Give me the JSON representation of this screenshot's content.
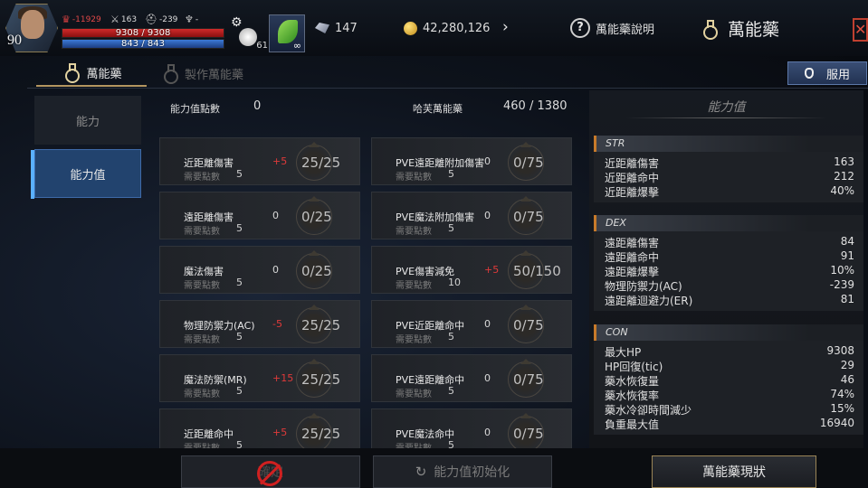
{
  "player": {
    "level": "90",
    "lawful": "-11929",
    "attack": "163",
    "defense": "-239",
    "trophy": "-",
    "hp": "9308 / 9308",
    "mp": "843 / 843",
    "pet_count": "61",
    "potion_count": "∞"
  },
  "currency": {
    "crystals": "147",
    "gold": "42,280,126"
  },
  "header": {
    "help_label": "萬能藥說明",
    "title": "萬能藥"
  },
  "tabs": {
    "active": "萬能藥",
    "inactive": "製作萬能藥",
    "use_button": "服用"
  },
  "nav": {
    "item1": "能力",
    "item2": "能力值"
  },
  "summary": {
    "points_label": "能力值點數",
    "points_value": "0",
    "global_label": "哈芙萬能藥",
    "global_value": "460 / 1380"
  },
  "req_label": "需要點數",
  "cards_left": [
    {
      "name": "近距離傷害",
      "delta": "+5",
      "level": "25/25",
      "req": "5"
    },
    {
      "name": "遠距離傷害",
      "delta": "0",
      "level": "0/25",
      "req": "5"
    },
    {
      "name": "魔法傷害",
      "delta": "0",
      "level": "0/25",
      "req": "5"
    },
    {
      "name": "物理防禦力(AC)",
      "delta": "-5",
      "level": "25/25",
      "req": "5"
    },
    {
      "name": "魔法防禦(MR)",
      "delta": "+15",
      "level": "25/25",
      "req": "5"
    },
    {
      "name": "近距離命中",
      "delta": "+5",
      "level": "25/25",
      "req": "5"
    }
  ],
  "cards_right": [
    {
      "name": "PVE遠距離附加傷害",
      "delta": "0",
      "level": "0/75",
      "req": "5"
    },
    {
      "name": "PVE魔法附加傷害",
      "delta": "0",
      "level": "0/75",
      "req": "5"
    },
    {
      "name": "PVE傷害減免",
      "delta": "+5",
      "level": "50/150",
      "req": "10"
    },
    {
      "name": "PVE近距離命中",
      "delta": "0",
      "level": "0/75",
      "req": "5"
    },
    {
      "name": "PVE遠距離命中",
      "delta": "0",
      "level": "0/75",
      "req": "5"
    },
    {
      "name": "PVE魔法命中",
      "delta": "0",
      "level": "0/75",
      "req": "5"
    }
  ],
  "stats_panel": {
    "title": "能力值",
    "str": {
      "label": "STR",
      "rows": [
        {
          "k": "近距離傷害",
          "v": "163"
        },
        {
          "k": "近距離命中",
          "v": "212"
        },
        {
          "k": "近距離爆擊",
          "v": "40%"
        }
      ]
    },
    "dex": {
      "label": "DEX",
      "rows": [
        {
          "k": "遠距離傷害",
          "v": "84"
        },
        {
          "k": "遠距離命中",
          "v": "91"
        },
        {
          "k": "遠距離爆擊",
          "v": "10%"
        },
        {
          "k": "物理防禦力(AC)",
          "v": "-239"
        },
        {
          "k": "遠距離迴避力(ER)",
          "v": "81"
        }
      ]
    },
    "con": {
      "label": "CON",
      "rows": [
        {
          "k": "最大HP",
          "v": "9308"
        },
        {
          "k": "HP回復(tic)",
          "v": "29"
        },
        {
          "k": "藥水恢復量",
          "v": "46"
        },
        {
          "k": "藥水恢復率",
          "v": "74%"
        },
        {
          "k": "藥水冷卻時間減少",
          "v": "15%"
        },
        {
          "k": "負重最大值",
          "v": "16940"
        }
      ]
    }
  },
  "bottom": {
    "btn1": "確定",
    "btn2": "能力值初始化",
    "btn3": "萬能藥現狀"
  }
}
